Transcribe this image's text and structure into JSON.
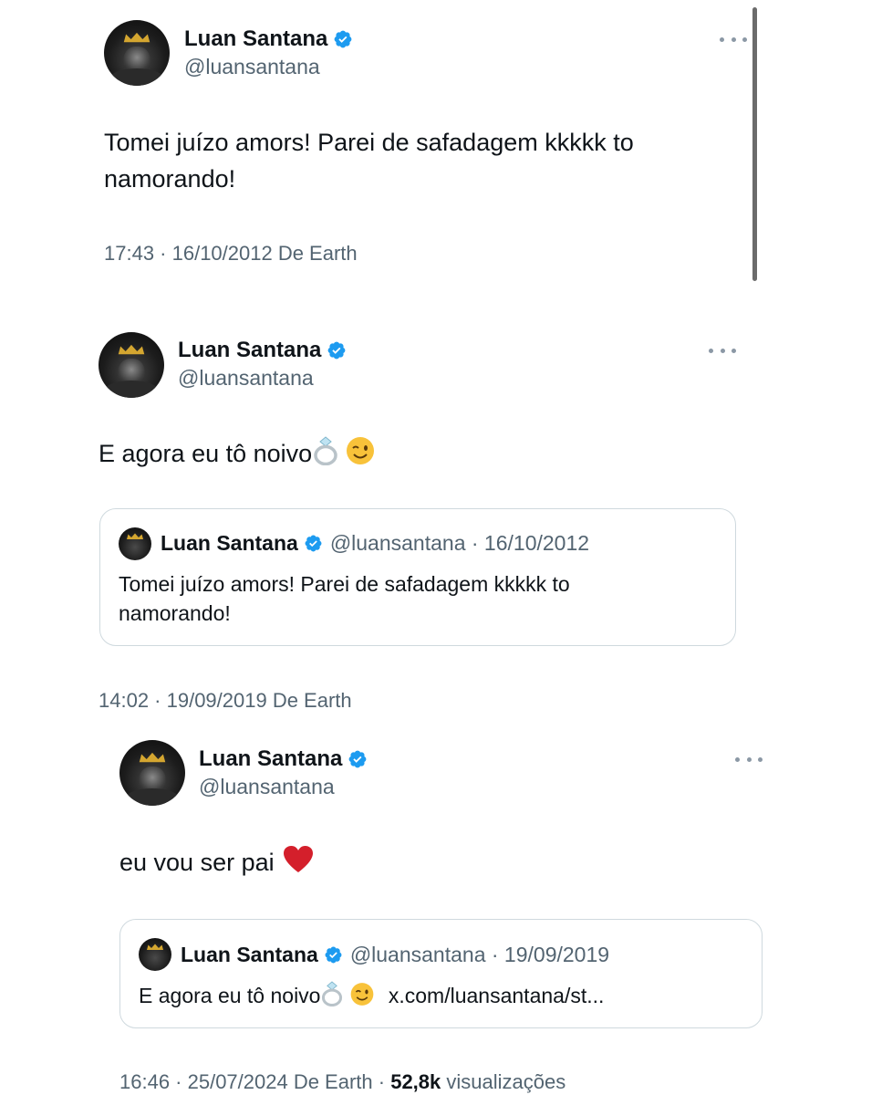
{
  "colors": {
    "verified": "#1d9bf0",
    "text": "#0f1419",
    "secondary": "#536471",
    "heart": "#d41f2b"
  },
  "tweet1": {
    "name": "Luan Santana",
    "handle": "@luansantana",
    "text_line1": "Tomei juízo amors! Parei de safadagem kkkkk to",
    "text_line2": "namorando!",
    "meta": "17:43 · 16/10/2012 De Earth"
  },
  "tweet2": {
    "name": "Luan Santana",
    "handle": "@luansantana",
    "text": "E agora eu tô noivo",
    "emoji": [
      "ring-emoji",
      "winking-face-emoji"
    ],
    "quote": {
      "name": "Luan Santana",
      "handle_date": "@luansantana · 16/10/2012",
      "text_line1": "Tomei juízo amors! Parei de safadagem kkkkk to",
      "text_line2": "namorando!"
    },
    "meta": "14:02 · 19/09/2019 De Earth"
  },
  "tweet3": {
    "name": "Luan Santana",
    "handle": "@luansantana",
    "text": "eu vou ser pai",
    "emoji": [
      "red-heart-emoji"
    ],
    "quote": {
      "name": "Luan Santana",
      "handle_date": "@luansantana · 19/09/2019",
      "text_before": "E agora eu tô noivo",
      "text_link": "x.com/luansantana/st..."
    },
    "meta_prefix": "16:46 · 25/07/2024 De Earth · ",
    "views_count": "52,8k",
    "views_label": " visualizações"
  }
}
